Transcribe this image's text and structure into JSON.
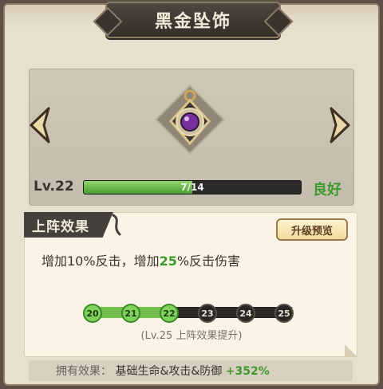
{
  "title": "黑金坠饰",
  "item": {
    "icon": "pendant-icon",
    "level_label": "Lv.22",
    "progress_text": "7/14",
    "progress_current": 7,
    "progress_max": 14,
    "status": "良好",
    "colors": {
      "bar_fill": "#5fb83f",
      "status": "#3f9a2e",
      "gem": "#7a2f9e"
    }
  },
  "deploy_effect": {
    "section_title": "上阵效果",
    "preview_button": "升级预览",
    "effect_prefix": "增加10%反击，增加",
    "effect_highlight": "25",
    "effect_suffix": "%反击伤害",
    "level_nodes": [
      "20",
      "21",
      "22",
      "23",
      "24",
      "25"
    ],
    "current_node": "22",
    "hint": "(Lv.25 上阵效果提升)"
  },
  "owned_effect": {
    "label": "拥有效果：",
    "text": "基础生命&攻击&防御",
    "value": "+352%"
  }
}
